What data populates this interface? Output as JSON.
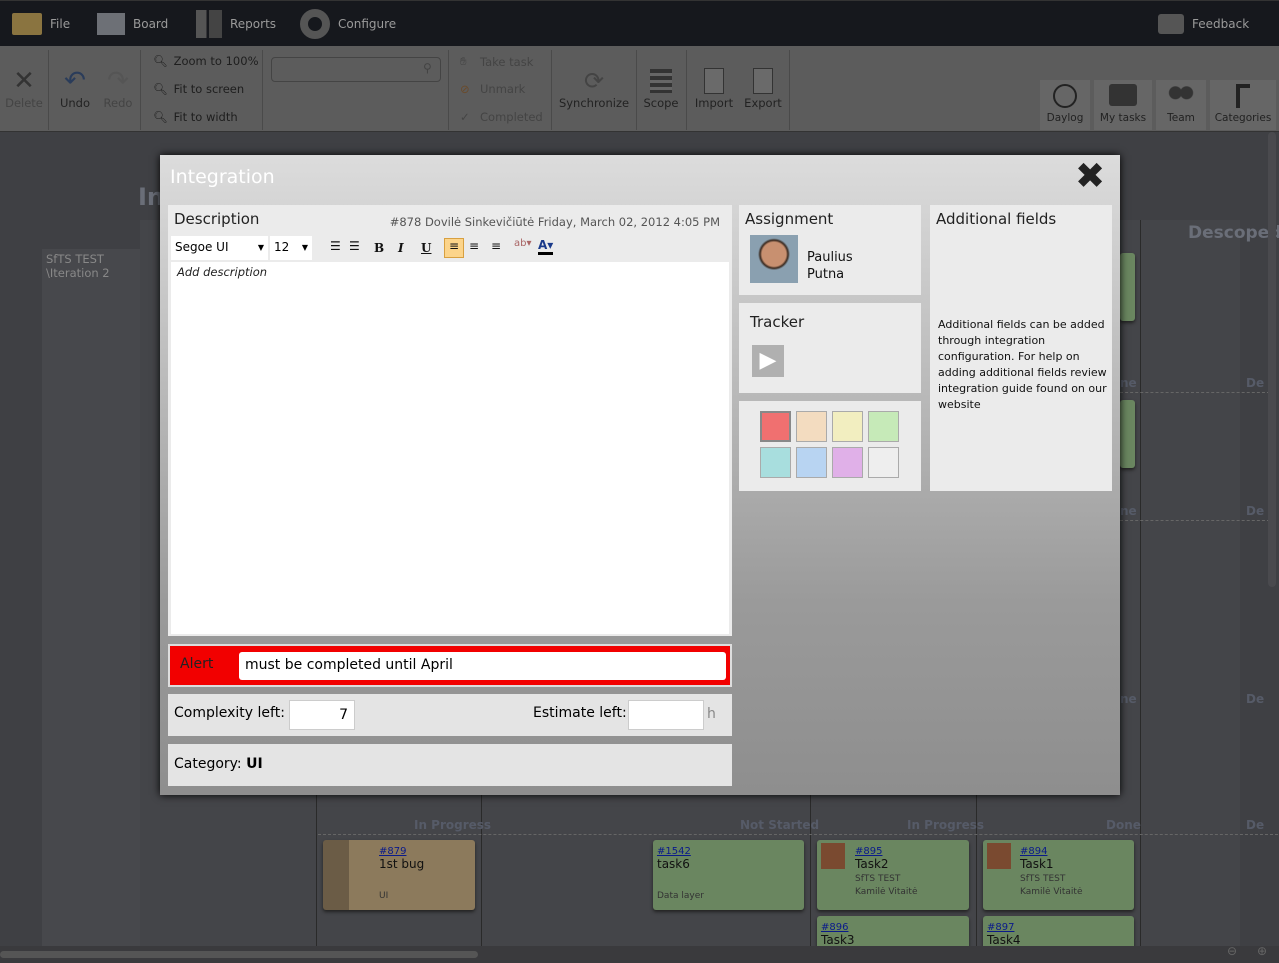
{
  "nav": {
    "items": [
      {
        "label": "File",
        "icon": "folder-icon"
      },
      {
        "label": "Board",
        "icon": "board-icon"
      },
      {
        "label": "Reports",
        "icon": "reports-icon"
      },
      {
        "label": "Configure",
        "icon": "gear-icon"
      }
    ],
    "feedback": "Feedback"
  },
  "toolbar": {
    "delete": "Delete",
    "undo": "Undo",
    "redo": "Redo",
    "zoom100": "Zoom to 100%",
    "fit_screen": "Fit to screen",
    "fit_width": "Fit to width",
    "search_placeholder": "",
    "take_task": "Take task",
    "unmark": "Unmark",
    "completed": "Completed",
    "synchronize": "Synchronize",
    "scope": "Scope",
    "import": "Import",
    "export": "Export",
    "daylog": "Daylog",
    "my_tasks": "My tasks",
    "team": "Team",
    "categories": "Categories"
  },
  "board": {
    "title_partial": "In",
    "sidebar": [
      "SfTS TEST",
      "\\Iteration 2"
    ],
    "descoped": "Descoped",
    "columns": [
      "In Progress",
      "Not Started",
      "In Progress",
      "Done",
      "De"
    ],
    "side_labels": [
      "ne",
      "De"
    ],
    "cards": [
      {
        "id": "#879",
        "title": "1st bug",
        "category": "UI",
        "color": "#8c7a5c"
      },
      {
        "id": "#1542",
        "title": "task6",
        "category": "Data layer",
        "color": "#6a8660"
      },
      {
        "id": "#895",
        "title": "Task2",
        "project": "SfTS TEST",
        "assignee": "Kamilė Vitaitė",
        "color": "#6a8660"
      },
      {
        "id": "#894",
        "title": "Task1",
        "project": "SfTS TEST",
        "assignee": "Kamilė Vitaitė",
        "color": "#6a8660"
      },
      {
        "id": "#896",
        "title": "Task3",
        "color": "#6a8660"
      },
      {
        "id": "#897",
        "title": "Task4",
        "color": "#6a8660"
      }
    ]
  },
  "dialog": {
    "title": "Integration",
    "description": {
      "label": "Description",
      "meta": "#878  Dovilė Sinkevičiūtė  Friday, March 02, 2012 4:05 PM",
      "font": "Segoe UI",
      "size": "12",
      "placeholder": "Add description"
    },
    "assignment": {
      "label": "Assignment",
      "name_first": "Paulius",
      "name_last": "Putna"
    },
    "tracker": {
      "label": "Tracker"
    },
    "colors": [
      "#f07070",
      "#f3dcc0",
      "#f2eec0",
      "#c6eab8",
      "#a8dede",
      "#b8d4f2",
      "#e0b0e8",
      "#eeeeee"
    ],
    "additional": {
      "label": "Additional fields",
      "text": "Additional fields can be added through integration configuration. For help on adding additional fields review integration guide found on our website"
    },
    "alert": {
      "label": "Alert",
      "value": "must be completed until April",
      "color": "#ff0000"
    },
    "complexity": {
      "label": "Complexity left:",
      "value": "7"
    },
    "estimate": {
      "label": "Estimate left:",
      "value": "",
      "unit": "h"
    },
    "category": {
      "label": "Category:",
      "value": "UI"
    }
  }
}
